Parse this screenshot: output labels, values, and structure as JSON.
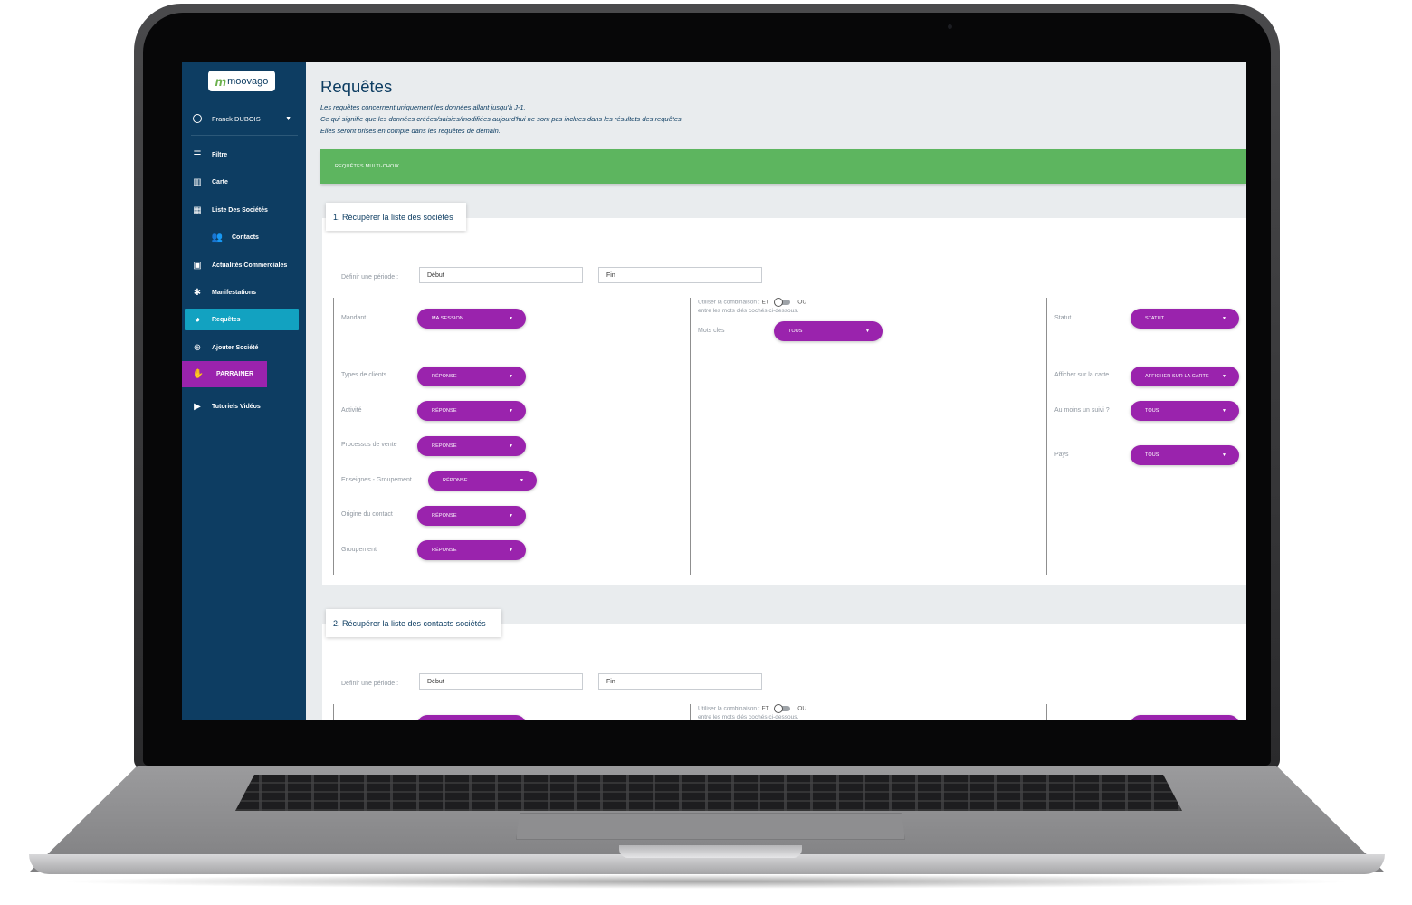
{
  "app": {
    "logo_text": "moovago"
  },
  "user": {
    "name": "Franck DUBOIS"
  },
  "sidebar": {
    "items": [
      {
        "label": "Filtre",
        "icon": "filter-icon"
      },
      {
        "label": "Carte",
        "icon": "map-icon"
      },
      {
        "label": "Liste Des Sociétés",
        "icon": "building-icon"
      },
      {
        "label": "Contacts",
        "icon": "people-icon"
      },
      {
        "label": "Actualités Commerciales",
        "icon": "calendar-icon"
      },
      {
        "label": "Manifestations",
        "icon": "ticket-icon"
      },
      {
        "label": "Requêtes",
        "icon": "pie-chart-icon"
      },
      {
        "label": "Ajouter Société",
        "icon": "add-circle-icon"
      },
      {
        "label": "PARRAINER",
        "icon": "handshake-icon"
      },
      {
        "label": "Tutoriels Vidéos",
        "icon": "video-icon"
      }
    ]
  },
  "page": {
    "title": "Requêtes",
    "info": [
      "Les requêtes concernent uniquement les données allant jusqu'à J-1.",
      "Ce qui signifie que les données créées/saisies/modifiées aujourd'hui ne sont pas inclues dans les résultats des requêtes.",
      "Elles seront prises en compte dans les requêtes de demain."
    ],
    "banner": "REQUÊTES MULTI-CHOIX"
  },
  "section1": {
    "title": "1. Récupérer la liste des sociétés",
    "period_label": "Définir une période :",
    "start_placeholder": "Début",
    "end_placeholder": "Fin",
    "combination": {
      "prefix": "Utiliser la combinaison :",
      "et": "ET",
      "ou": "OU",
      "suffix": "entre les mots clés cochés ci-dessous."
    },
    "left_fields": [
      {
        "label": "Mandant",
        "value": "MA SESSION"
      },
      {
        "label": "Types de clients",
        "value": "RÉPONSE"
      },
      {
        "label": "Activité",
        "value": "RÉPONSE"
      },
      {
        "label": "Processus de vente",
        "value": "RÉPONSE"
      },
      {
        "label": "Enseignes - Groupement",
        "value": "RÉPONSE"
      },
      {
        "label": "Origine du contact",
        "value": "RÉPONSE"
      },
      {
        "label": "Groupement",
        "value": "RÉPONSE"
      }
    ],
    "keywords": {
      "label": "Mots clés",
      "value": "TOUS"
    },
    "right_fields": [
      {
        "label": "Statut",
        "value": "STATUT"
      },
      {
        "label": "Afficher sur la carte",
        "value": "AFFICHER SUR LA CARTE"
      },
      {
        "label": "Au moins un suivi ?",
        "value": "TOUS"
      },
      {
        "label": "Pays",
        "value": "TOUS"
      }
    ]
  },
  "section2": {
    "title": "2. Récupérer la liste des contacts sociétés",
    "period_label": "Définir une période :",
    "start_placeholder": "Début",
    "end_placeholder": "Fin",
    "combination": {
      "prefix": "Utiliser la combinaison :",
      "et": "ET",
      "ou": "OU",
      "suffix": "entre les mots clés cochés ci-dessous."
    }
  },
  "colors": {
    "sidebar": "#0d3d62",
    "active": "#12a2c1",
    "accent": "#9a23ad",
    "banner": "#5db55f"
  }
}
